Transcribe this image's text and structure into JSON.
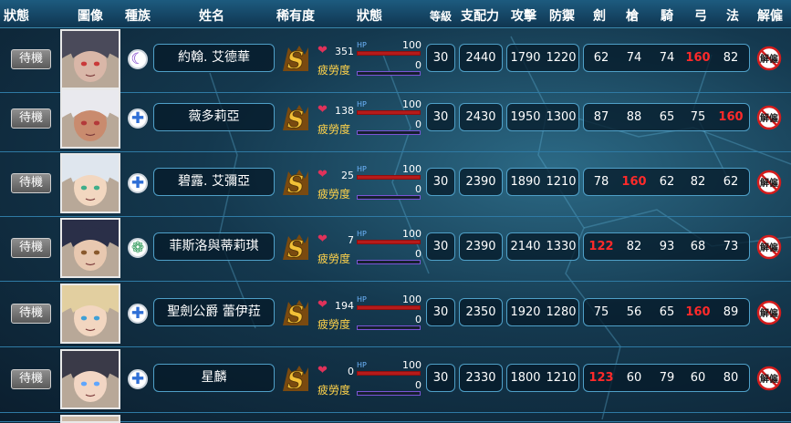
{
  "header": {
    "status": "狀態",
    "portrait": "圖像",
    "race": "種族",
    "name": "姓名",
    "rarity": "稀有度",
    "state": "狀態",
    "level": "等級",
    "control": "支配力",
    "attack": "攻擊",
    "defense": "防禦",
    "sword": "劍",
    "spear": "槍",
    "ride": "騎",
    "bow": "弓",
    "magic": "法",
    "release": "解僱"
  },
  "labels": {
    "wait": "待機",
    "fatigue": "疲勞度",
    "hp": "HP",
    "release_text": "解僱"
  },
  "colors": {
    "highlight": "#ff2a2a",
    "rarity_gold": "#f2c037",
    "heart": "#e0325a"
  },
  "rows": [
    {
      "name": "約翰. 艾德華",
      "race_icon": "dark-moon-icon",
      "love": "351",
      "hp": "100",
      "fatigue": "0",
      "level": "30",
      "control": "2440",
      "attack": "1790",
      "defense": "1220",
      "sword": "62",
      "spear": "74",
      "ride": "74",
      "bow": "160",
      "magic": "82",
      "hi": "bow"
    },
    {
      "name": "薇多莉亞",
      "race_icon": "holy-cross-icon",
      "love": "138",
      "hp": "100",
      "fatigue": "0",
      "level": "30",
      "control": "2430",
      "attack": "1950",
      "defense": "1300",
      "sword": "87",
      "spear": "88",
      "ride": "65",
      "bow": "75",
      "magic": "160",
      "hi": "magic"
    },
    {
      "name": "碧露. 艾彌亞",
      "race_icon": "holy-cross-icon",
      "love": "25",
      "hp": "100",
      "fatigue": "0",
      "level": "30",
      "control": "2390",
      "attack": "1890",
      "defense": "1210",
      "sword": "78",
      "spear": "160",
      "ride": "62",
      "bow": "82",
      "magic": "62",
      "hi": "spear"
    },
    {
      "name": "菲斯洛與蒂莉琪",
      "race_icon": "nature-swirl-icon",
      "love": "7",
      "hp": "100",
      "fatigue": "0",
      "level": "30",
      "control": "2390",
      "attack": "2140",
      "defense": "1330",
      "sword": "122",
      "spear": "82",
      "ride": "93",
      "bow": "68",
      "magic": "73",
      "hi": "sword"
    },
    {
      "name": "聖劍公爵 蕾伊菈",
      "race_icon": "holy-cross-icon",
      "love": "194",
      "hp": "100",
      "fatigue": "0",
      "level": "30",
      "control": "2350",
      "attack": "1920",
      "defense": "1280",
      "sword": "75",
      "spear": "56",
      "ride": "65",
      "bow": "160",
      "magic": "89",
      "hi": "bow"
    },
    {
      "name": "星麟",
      "race_icon": "holy-cross-icon",
      "love": "0",
      "hp": "100",
      "fatigue": "0",
      "level": "30",
      "control": "2330",
      "attack": "1800",
      "defense": "1210",
      "sword": "123",
      "spear": "60",
      "ride": "79",
      "bow": "60",
      "magic": "80",
      "hi": "sword"
    }
  ]
}
